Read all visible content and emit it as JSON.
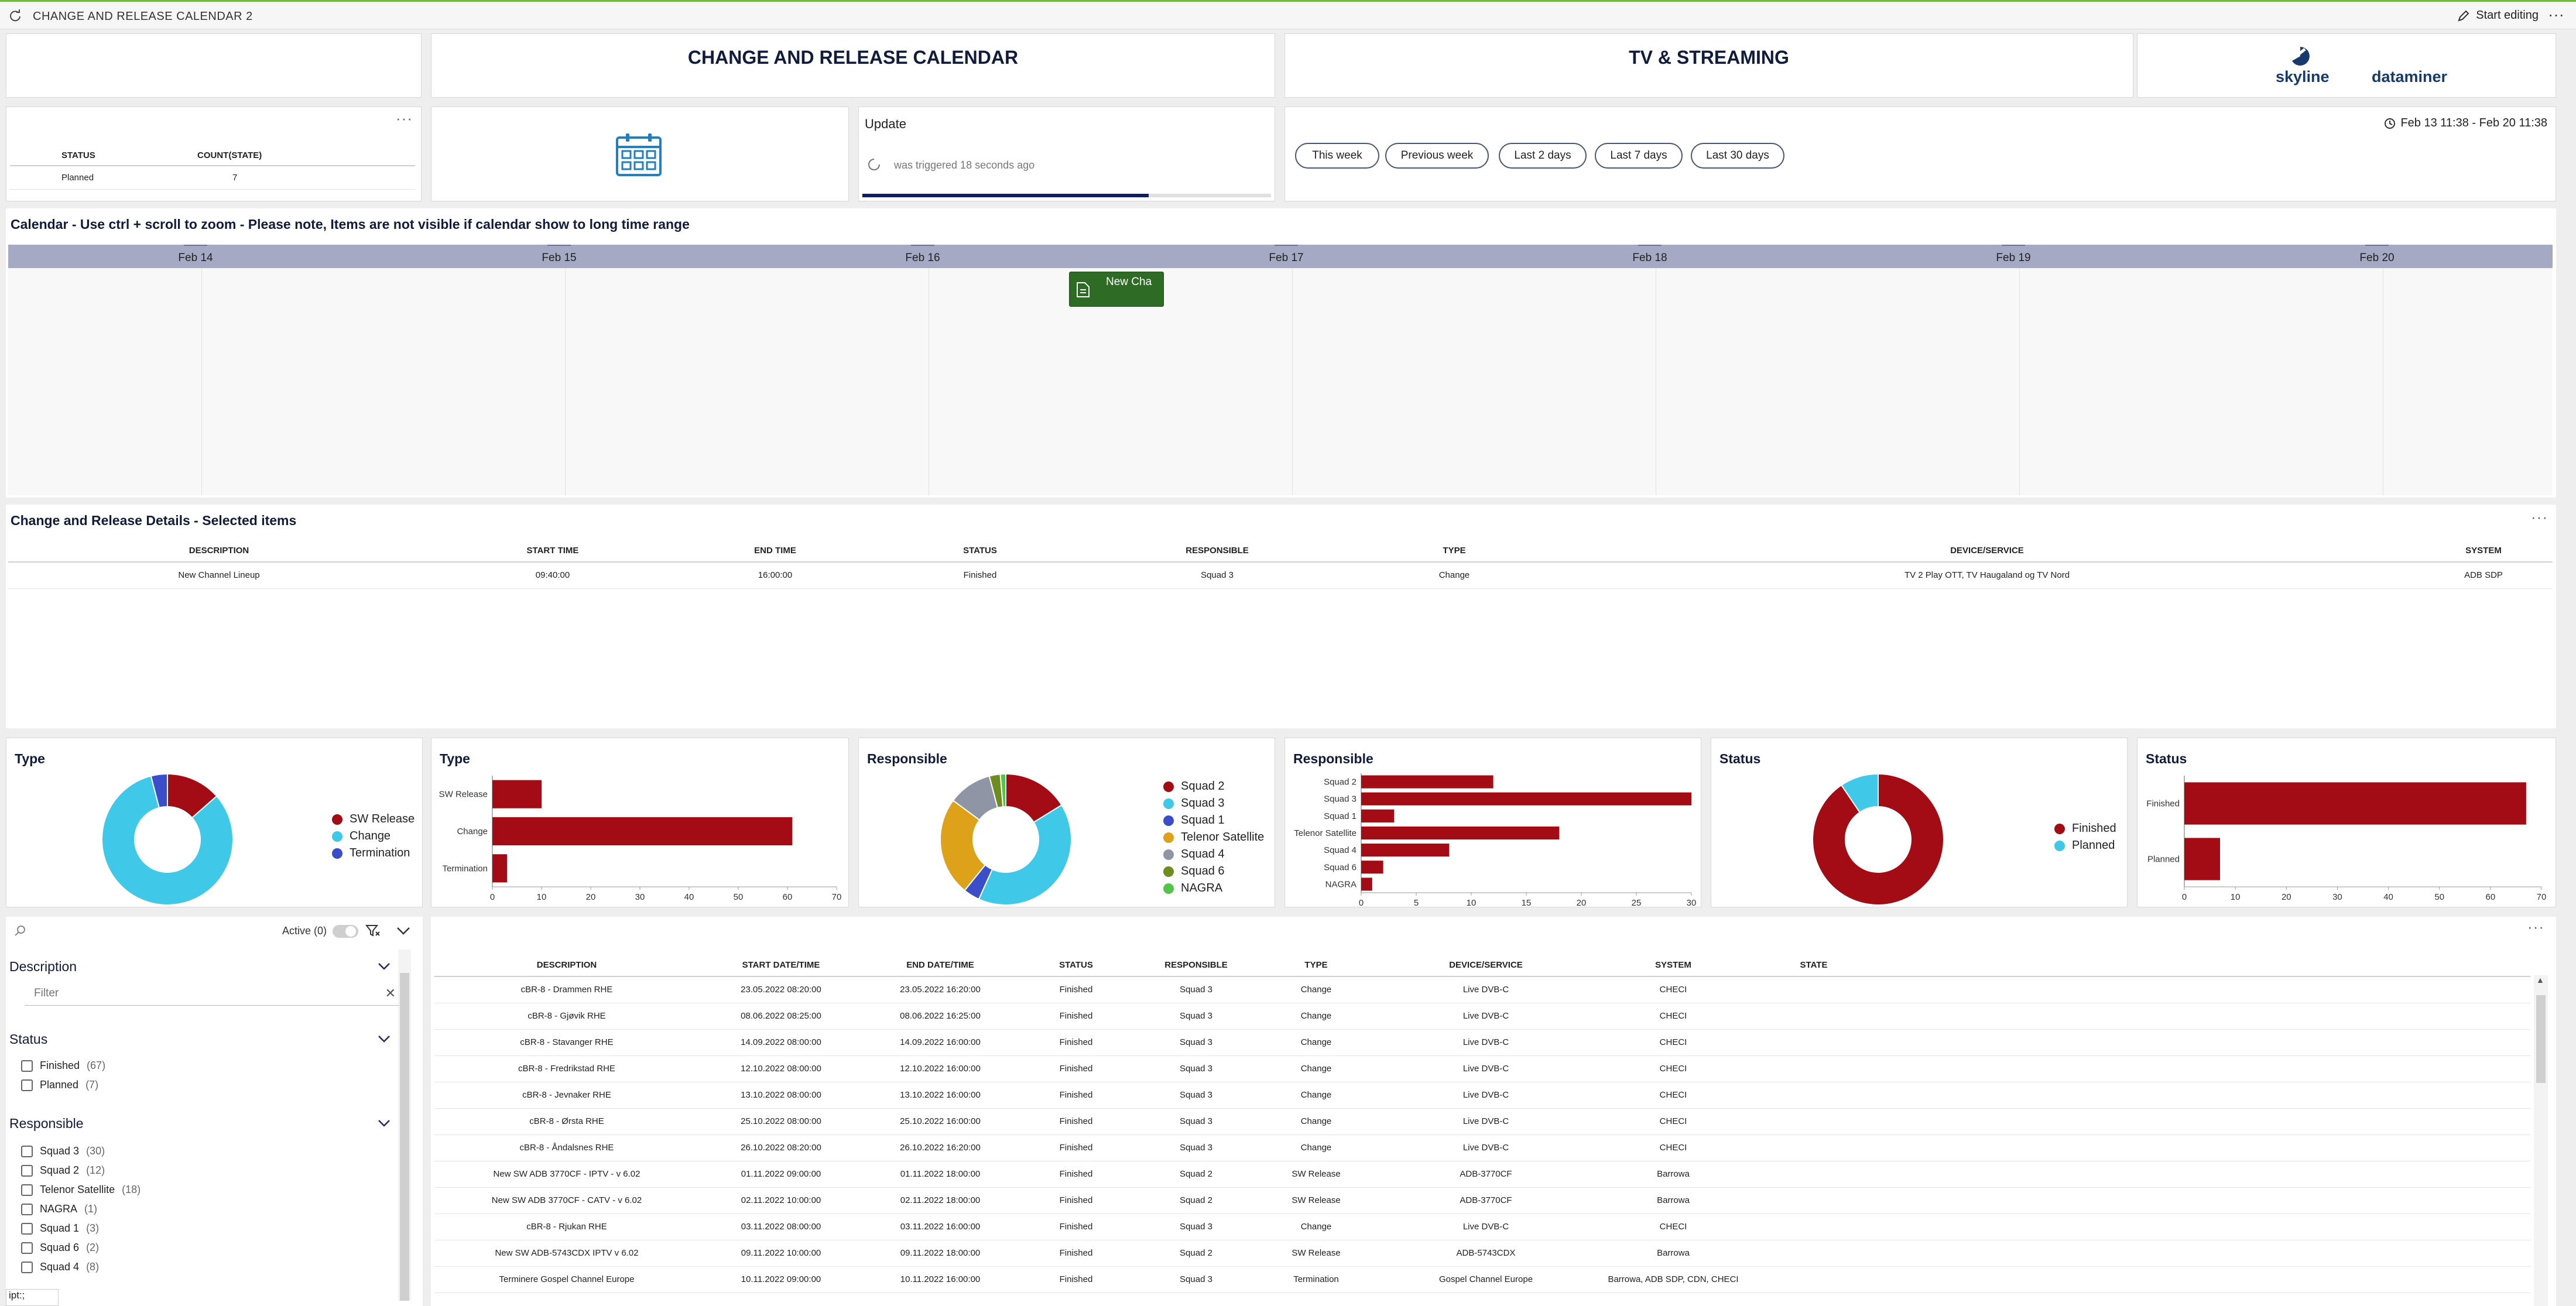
{
  "window": {
    "title": "CHANGE AND RELEASE CALENDAR 2",
    "edit_label": "Start editing"
  },
  "header": {
    "title": "CHANGE AND RELEASE CALENDAR",
    "subtitle": "TV & STREAMING",
    "logo_left": "skyline",
    "logo_right": "dataminer"
  },
  "status_count": {
    "columns": [
      "STATUS",
      "COUNT(STATE)"
    ],
    "rows": [
      [
        "Planned",
        "7"
      ]
    ]
  },
  "update": {
    "title": "Update",
    "status": "was triggered 18 seconds ago",
    "progress": 0.7
  },
  "range_buttons": [
    "This week",
    "Previous week",
    "Last 2 days",
    "Last 7 days",
    "Last 30 days"
  ],
  "date_range": "Feb 13 11:38 - Feb 20 11:38",
  "calendar": {
    "title": "Calendar - Use ctrl + scroll to zoom - Please note, Items are not visible if calendar show to long time range",
    "days": [
      "Feb 14",
      "Feb 15",
      "Feb 16",
      "Feb 17",
      "Feb 18",
      "Feb 19",
      "Feb 20"
    ],
    "event_label": "New Cha"
  },
  "details": {
    "title": "Change and Release Details - Selected items",
    "columns": [
      "DESCRIPTION",
      "START TIME",
      "END TIME",
      "STATUS",
      "RESPONSIBLE",
      "TYPE",
      "DEVICE/SERVICE",
      "SYSTEM"
    ],
    "rows": [
      [
        "New Channel Lineup",
        "09:40:00",
        "16:00:00",
        "Finished",
        "Squad 3",
        "Change",
        "TV 2 Play OTT, TV Haugaland og TV Nord",
        "ADB SDP"
      ]
    ]
  },
  "colors": {
    "dark_red": "#a30c14",
    "light_blue": "#40c8e8",
    "blue": "#3b4dc8",
    "orange": "#dea21a",
    "grey": "#8e95a5",
    "olive": "#6f8c1e",
    "green": "#52c44a",
    "navy": "#111b3c",
    "event_green": "#2e6b25"
  },
  "chart_data": [
    {
      "type": "pie",
      "title": "Type",
      "labels": [
        "SW Release",
        "Change",
        "Termination"
      ],
      "values": [
        10,
        61,
        3
      ],
      "colors": [
        "#a30c14",
        "#40c8e8",
        "#3b4dc8"
      ]
    },
    {
      "type": "bar",
      "title": "Type",
      "orientation": "horizontal",
      "categories": [
        "SW Release",
        "Change",
        "Termination"
      ],
      "values": [
        10,
        61,
        3
      ],
      "xlim": [
        0,
        70
      ],
      "ticks": [
        0,
        10,
        20,
        30,
        40,
        50,
        60,
        70
      ]
    },
    {
      "type": "pie",
      "title": "Responsible",
      "labels": [
        "Squad 2",
        "Squad 3",
        "Squad 1",
        "Telenor Satellite",
        "Squad 4",
        "Squad 6",
        "NAGRA"
      ],
      "values": [
        12,
        30,
        3,
        18,
        8,
        2,
        1
      ],
      "colors": [
        "#a30c14",
        "#40c8e8",
        "#3b4dc8",
        "#dea21a",
        "#8e95a5",
        "#6f8c1e",
        "#52c44a"
      ]
    },
    {
      "type": "bar",
      "title": "Responsible",
      "orientation": "horizontal",
      "categories": [
        "Squad 2",
        "Squad 3",
        "Squad 1",
        "Telenor Satellite",
        "Squad 4",
        "Squad 6",
        "NAGRA"
      ],
      "values": [
        12,
        30,
        3,
        18,
        8,
        2,
        1
      ],
      "xlim": [
        0,
        30
      ],
      "ticks": [
        0,
        5,
        10,
        15,
        20,
        25,
        30
      ]
    },
    {
      "type": "pie",
      "title": "Status",
      "labels": [
        "Finished",
        "Planned"
      ],
      "values": [
        67,
        7
      ],
      "colors": [
        "#a30c14",
        "#40c8e8"
      ]
    },
    {
      "type": "bar",
      "title": "Status",
      "orientation": "horizontal",
      "categories": [
        "Finished",
        "Planned"
      ],
      "values": [
        67,
        7
      ],
      "xlim": [
        0,
        70
      ],
      "ticks": [
        0,
        10,
        20,
        30,
        40,
        50,
        60,
        70
      ]
    }
  ],
  "filters": {
    "active_label": "Active (0)",
    "search_placeholder": "",
    "description": {
      "title": "Description",
      "placeholder": "Filter"
    },
    "status": {
      "title": "Status",
      "items": [
        {
          "label": "Finished",
          "count": "(67)"
        },
        {
          "label": "Planned",
          "count": "(7)"
        }
      ]
    },
    "responsible": {
      "title": "Responsible",
      "items": [
        {
          "label": "Squad 3",
          "count": "(30)"
        },
        {
          "label": "Squad 2",
          "count": "(12)"
        },
        {
          "label": "Telenor Satellite",
          "count": "(18)"
        },
        {
          "label": "NAGRA",
          "count": "(1)"
        },
        {
          "label": "Squad 1",
          "count": "(3)"
        },
        {
          "label": "Squad 6",
          "count": "(2)"
        },
        {
          "label": "Squad 4",
          "count": "(8)"
        }
      ]
    }
  },
  "main_table": {
    "columns": [
      "DESCRIPTION",
      "START DATE/TIME",
      "END DATE/TIME",
      "STATUS",
      "RESPONSIBLE",
      "TYPE",
      "DEVICE/SERVICE",
      "SYSTEM",
      "STATE"
    ],
    "rows": [
      [
        "cBR-8 - Drammen RHE",
        "23.05.2022 08:20:00",
        "23.05.2022 16:20:00",
        "Finished",
        "Squad 3",
        "Change",
        "Live DVB-C",
        "CHECI",
        ""
      ],
      [
        "cBR-8 - Gjøvik RHE",
        "08.06.2022 08:25:00",
        "08.06.2022 16:25:00",
        "Finished",
        "Squad 3",
        "Change",
        "Live DVB-C",
        "CHECI",
        ""
      ],
      [
        "cBR-8 - Stavanger RHE",
        "14.09.2022 08:00:00",
        "14.09.2022 16:00:00",
        "Finished",
        "Squad 3",
        "Change",
        "Live DVB-C",
        "CHECI",
        ""
      ],
      [
        "cBR-8 - Fredrikstad RHE",
        "12.10.2022 08:00:00",
        "12.10.2022 16:00:00",
        "Finished",
        "Squad 3",
        "Change",
        "Live DVB-C",
        "CHECI",
        ""
      ],
      [
        "cBR-8 - Jevnaker RHE",
        "13.10.2022 08:00:00",
        "13.10.2022 16:00:00",
        "Finished",
        "Squad 3",
        "Change",
        "Live DVB-C",
        "CHECI",
        ""
      ],
      [
        "cBR-8 - Ørsta RHE",
        "25.10.2022 08:00:00",
        "25.10.2022 16:00:00",
        "Finished",
        "Squad 3",
        "Change",
        "Live DVB-C",
        "CHECI",
        ""
      ],
      [
        "cBR-8 - Åndalsnes RHE",
        "26.10.2022 08:20:00",
        "26.10.2022 16:20:00",
        "Finished",
        "Squad 3",
        "Change",
        "Live DVB-C",
        "CHECI",
        ""
      ],
      [
        "New SW ADB 3770CF - IPTV - v 6.02",
        "01.11.2022 09:00:00",
        "01.11.2022 18:00:00",
        "Finished",
        "Squad 2",
        "SW Release",
        "ADB-3770CF",
        "Barrowa",
        ""
      ],
      [
        "New SW ADB 3770CF - CATV - v 6.02",
        "02.11.2022 10:00:00",
        "02.11.2022 18:00:00",
        "Finished",
        "Squad 2",
        "SW Release",
        "ADB-3770CF",
        "Barrowa",
        ""
      ],
      [
        "cBR-8 - Rjukan RHE",
        "03.11.2022 08:00:00",
        "03.11.2022 16:00:00",
        "Finished",
        "Squad 3",
        "Change",
        "Live DVB-C",
        "CHECI",
        ""
      ],
      [
        "New SW ADB-5743CDX IPTV v 6.02",
        "09.11.2022 10:00:00",
        "09.11.2022 18:00:00",
        "Finished",
        "Squad 2",
        "SW Release",
        "ADB-5743CDX",
        "Barrowa",
        ""
      ],
      [
        "Terminere Gospel Channel Europe",
        "10.11.2022 09:00:00",
        "10.11.2022 16:00:00",
        "Finished",
        "Squad 3",
        "Termination",
        "Gospel Channel Europe",
        "Barrowa, ADB SDP, CDN, CHECI",
        ""
      ]
    ]
  },
  "status_bar_text": "ipt:;"
}
